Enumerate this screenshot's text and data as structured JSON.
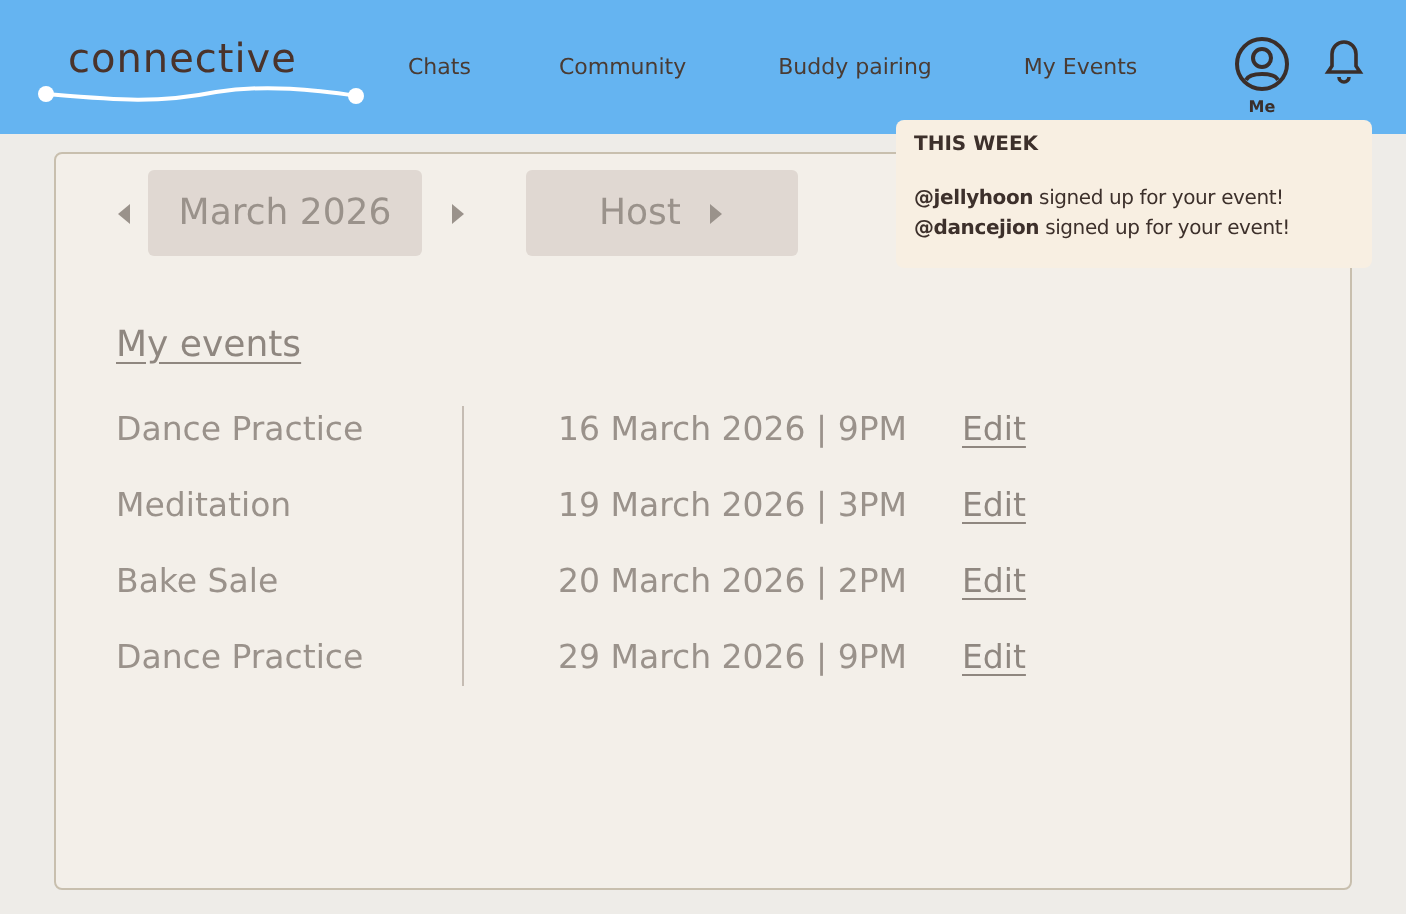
{
  "logo": "connective",
  "nav": [
    {
      "label": "Chats"
    },
    {
      "label": "Community"
    },
    {
      "label": "Buddy pairing"
    },
    {
      "label": "My Events"
    }
  ],
  "profile": {
    "label": "Me"
  },
  "notifications": {
    "title": "THIS WEEK",
    "items": [
      "**@jellyhoon** signed up for your event!",
      "**@dancejion** signed up for your event!"
    ]
  },
  "month_picker": {
    "value": "March 2026"
  },
  "role_picker": {
    "value": "Host"
  },
  "section_title": "My events",
  "events": [
    {
      "name": "Dance Practice",
      "datetime": "16 March 2026 | 9PM",
      "action": "Edit"
    },
    {
      "name": "Meditation",
      "datetime": "19 March 2026 | 3PM",
      "action": "Edit"
    },
    {
      "name": "Bake Sale",
      "datetime": "20 March 2026 | 2PM",
      "action": "Edit"
    },
    {
      "name": "Dance Practice",
      "datetime": "29 March 2026 | 9PM",
      "action": "Edit"
    }
  ]
}
